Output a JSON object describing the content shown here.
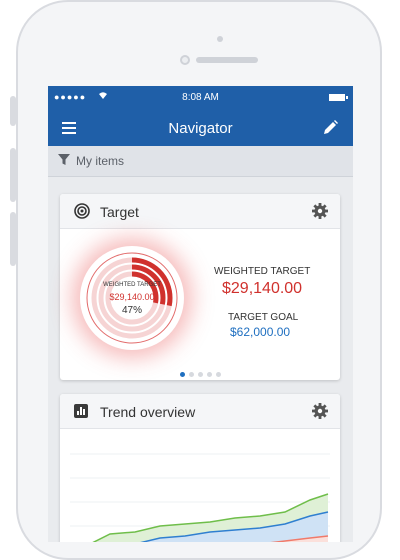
{
  "status_bar": {
    "signal": "●●●●● ",
    "time": "8:08 AM"
  },
  "nav": {
    "title": "Navigator"
  },
  "filter": {
    "label": "My items"
  },
  "target_card": {
    "title": "Target",
    "ring": {
      "label": "WEIGHTED TARGET",
      "value": "$29,140.00",
      "percent_text": "47%",
      "percent": 0.47
    },
    "weighted_target_label": "WEIGHTED TARGET",
    "weighted_target_value": "$29,140.00",
    "target_goal_label": "TARGET GOAL",
    "target_goal_value": "$62,000.00",
    "page_count": 5,
    "active_page": 0
  },
  "trend_card": {
    "title": "Trend overview"
  },
  "colors": {
    "brand": "#1f5fa8",
    "accent_red": "#d0312d",
    "accent_blue": "#1f6fc0",
    "series_green": "#6fbe4a",
    "series_blue": "#2f7fd0",
    "series_red": "#f07a6a"
  },
  "icons": {
    "menu": "hamburger-icon",
    "edit": "pencil-icon",
    "filter": "funnel-icon",
    "target": "target-icon",
    "settings": "gear-icon",
    "trend": "bar-chart-icon"
  }
}
